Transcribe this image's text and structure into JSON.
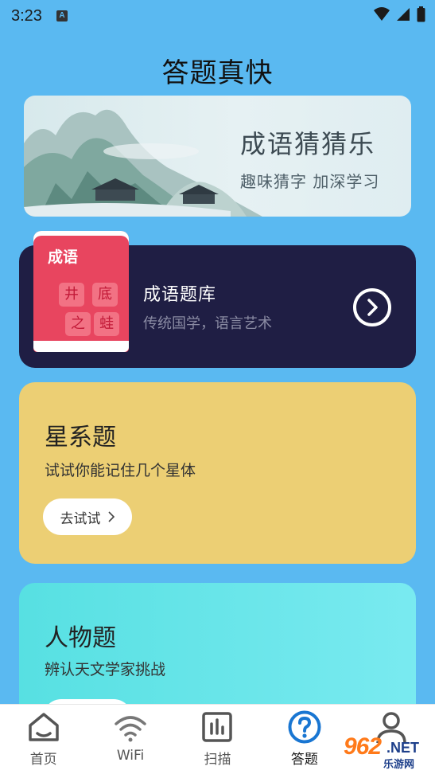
{
  "status_bar": {
    "time": "3:23",
    "notification_badge": "A"
  },
  "page_title": "答题真快",
  "banner": {
    "title": "成语猜猜乐",
    "subtitle": "趣味猜字 加深学习"
  },
  "idiom_card": {
    "book_label": "成语",
    "tiles": [
      "井",
      "底",
      "之",
      "蛙"
    ],
    "title": "成语题库",
    "subtitle": "传统国学，语言艺术",
    "icon": "chevron-right-circle-icon"
  },
  "star_card": {
    "title": "星系题",
    "subtitle": "试试你能记住几个星体",
    "button_label": "去试试",
    "button_icon": "chevron-right-icon"
  },
  "person_card": {
    "title": "人物题",
    "subtitle": "辨认天文学家挑战"
  },
  "bottom_nav": {
    "items": [
      {
        "label": "首页",
        "icon": "home-icon",
        "active": false
      },
      {
        "label": "WiFi",
        "icon": "wifi-icon",
        "active": false
      },
      {
        "label": "扫描",
        "icon": "scan-chart-icon",
        "active": false
      },
      {
        "label": "答题",
        "icon": "question-circle-icon",
        "active": true
      },
      {
        "label": "",
        "icon": "user-icon",
        "active": false
      }
    ]
  },
  "watermark": {
    "brand_number": "962",
    "brand_suffix": ".NET",
    "brand_cn": "乐游网"
  },
  "colors": {
    "background": "#5ab9f1",
    "idiom_card": "#1f1e44",
    "book": "#e8455f",
    "star_card": "#eccf74",
    "person_card": "#57e0e2",
    "active_nav": "#1976d2"
  }
}
